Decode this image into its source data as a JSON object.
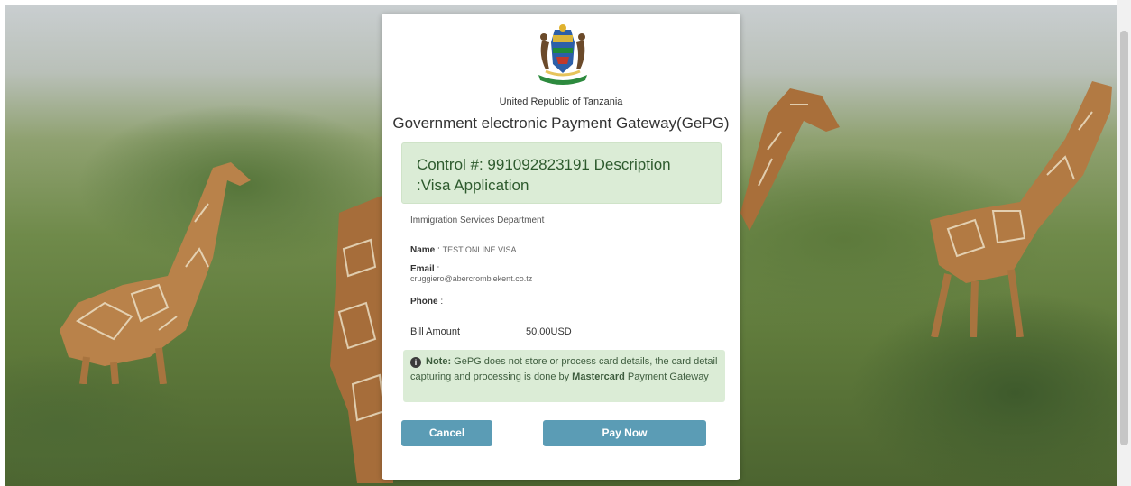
{
  "header": {
    "country": "United Republic of Tanzania",
    "gateway_title": "Government electronic Payment Gateway(GePG)"
  },
  "control": {
    "text": "Control #: 991092823191 Description :Visa Application"
  },
  "details": {
    "department": "Immigration Services Department",
    "name_label": "Name",
    "name_value": "TEST ONLINE VISA",
    "email_label": "Email",
    "email_value": "cruggiero@abercrombiekent.co.tz",
    "phone_label": "Phone",
    "phone_value": "",
    "bill_label": "Bill Amount",
    "bill_value": "50.00USD"
  },
  "note": {
    "label": "Note:",
    "text_before": " GePG does not store or process card details, the card detail capturing and processing is done by ",
    "brand": "Mastercard",
    "text_after": " Payment Gateway"
  },
  "actions": {
    "cancel_label": "Cancel",
    "pay_label": "Pay Now"
  },
  "colors": {
    "button": "#5b9cb5",
    "note_bg": "#dbecd6"
  },
  "icons": {
    "emblem": "coat-of-arms-icon",
    "note": "info-icon"
  }
}
